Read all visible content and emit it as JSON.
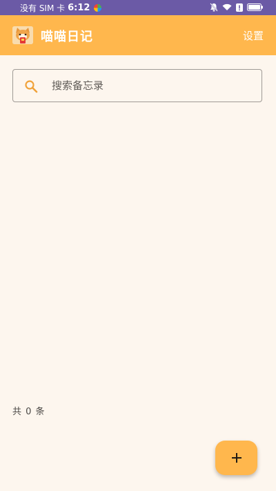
{
  "status_bar": {
    "carrier": "没有 SIM 卡",
    "time": "6:12"
  },
  "app_bar": {
    "title": "喵喵日记",
    "settings_label": "设置"
  },
  "search": {
    "placeholder": "搜索备忘录",
    "value": ""
  },
  "list": {
    "count_label": "共 0 条"
  },
  "colors": {
    "accent": "#ffb74d",
    "background": "#fdf6ee",
    "status_bar": "#6b5aa6"
  },
  "icons": {
    "search": "search-icon",
    "add": "plus-icon",
    "logo": "cat-logo-icon"
  }
}
